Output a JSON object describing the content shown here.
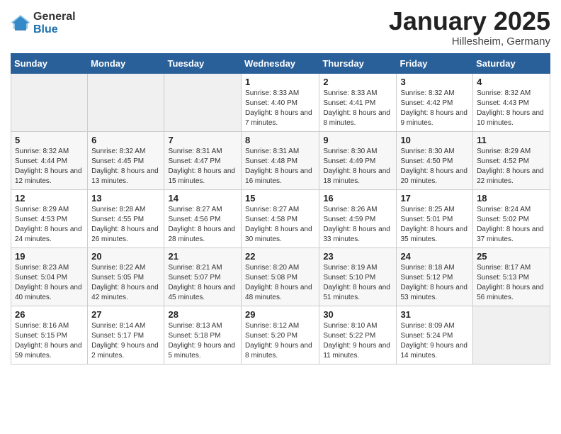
{
  "logo": {
    "general": "General",
    "blue": "Blue"
  },
  "header": {
    "month": "January 2025",
    "location": "Hillesheim, Germany"
  },
  "weekdays": [
    "Sunday",
    "Monday",
    "Tuesday",
    "Wednesday",
    "Thursday",
    "Friday",
    "Saturday"
  ],
  "weeks": [
    [
      {
        "day": "",
        "sunrise": "",
        "sunset": "",
        "daylight": ""
      },
      {
        "day": "",
        "sunrise": "",
        "sunset": "",
        "daylight": ""
      },
      {
        "day": "",
        "sunrise": "",
        "sunset": "",
        "daylight": ""
      },
      {
        "day": "1",
        "sunrise": "Sunrise: 8:33 AM",
        "sunset": "Sunset: 4:40 PM",
        "daylight": "Daylight: 8 hours and 7 minutes."
      },
      {
        "day": "2",
        "sunrise": "Sunrise: 8:33 AM",
        "sunset": "Sunset: 4:41 PM",
        "daylight": "Daylight: 8 hours and 8 minutes."
      },
      {
        "day": "3",
        "sunrise": "Sunrise: 8:32 AM",
        "sunset": "Sunset: 4:42 PM",
        "daylight": "Daylight: 8 hours and 9 minutes."
      },
      {
        "day": "4",
        "sunrise": "Sunrise: 8:32 AM",
        "sunset": "Sunset: 4:43 PM",
        "daylight": "Daylight: 8 hours and 10 minutes."
      }
    ],
    [
      {
        "day": "5",
        "sunrise": "Sunrise: 8:32 AM",
        "sunset": "Sunset: 4:44 PM",
        "daylight": "Daylight: 8 hours and 12 minutes."
      },
      {
        "day": "6",
        "sunrise": "Sunrise: 8:32 AM",
        "sunset": "Sunset: 4:45 PM",
        "daylight": "Daylight: 8 hours and 13 minutes."
      },
      {
        "day": "7",
        "sunrise": "Sunrise: 8:31 AM",
        "sunset": "Sunset: 4:47 PM",
        "daylight": "Daylight: 8 hours and 15 minutes."
      },
      {
        "day": "8",
        "sunrise": "Sunrise: 8:31 AM",
        "sunset": "Sunset: 4:48 PM",
        "daylight": "Daylight: 8 hours and 16 minutes."
      },
      {
        "day": "9",
        "sunrise": "Sunrise: 8:30 AM",
        "sunset": "Sunset: 4:49 PM",
        "daylight": "Daylight: 8 hours and 18 minutes."
      },
      {
        "day": "10",
        "sunrise": "Sunrise: 8:30 AM",
        "sunset": "Sunset: 4:50 PM",
        "daylight": "Daylight: 8 hours and 20 minutes."
      },
      {
        "day": "11",
        "sunrise": "Sunrise: 8:29 AM",
        "sunset": "Sunset: 4:52 PM",
        "daylight": "Daylight: 8 hours and 22 minutes."
      }
    ],
    [
      {
        "day": "12",
        "sunrise": "Sunrise: 8:29 AM",
        "sunset": "Sunset: 4:53 PM",
        "daylight": "Daylight: 8 hours and 24 minutes."
      },
      {
        "day": "13",
        "sunrise": "Sunrise: 8:28 AM",
        "sunset": "Sunset: 4:55 PM",
        "daylight": "Daylight: 8 hours and 26 minutes."
      },
      {
        "day": "14",
        "sunrise": "Sunrise: 8:27 AM",
        "sunset": "Sunset: 4:56 PM",
        "daylight": "Daylight: 8 hours and 28 minutes."
      },
      {
        "day": "15",
        "sunrise": "Sunrise: 8:27 AM",
        "sunset": "Sunset: 4:58 PM",
        "daylight": "Daylight: 8 hours and 30 minutes."
      },
      {
        "day": "16",
        "sunrise": "Sunrise: 8:26 AM",
        "sunset": "Sunset: 4:59 PM",
        "daylight": "Daylight: 8 hours and 33 minutes."
      },
      {
        "day": "17",
        "sunrise": "Sunrise: 8:25 AM",
        "sunset": "Sunset: 5:01 PM",
        "daylight": "Daylight: 8 hours and 35 minutes."
      },
      {
        "day": "18",
        "sunrise": "Sunrise: 8:24 AM",
        "sunset": "Sunset: 5:02 PM",
        "daylight": "Daylight: 8 hours and 37 minutes."
      }
    ],
    [
      {
        "day": "19",
        "sunrise": "Sunrise: 8:23 AM",
        "sunset": "Sunset: 5:04 PM",
        "daylight": "Daylight: 8 hours and 40 minutes."
      },
      {
        "day": "20",
        "sunrise": "Sunrise: 8:22 AM",
        "sunset": "Sunset: 5:05 PM",
        "daylight": "Daylight: 8 hours and 42 minutes."
      },
      {
        "day": "21",
        "sunrise": "Sunrise: 8:21 AM",
        "sunset": "Sunset: 5:07 PM",
        "daylight": "Daylight: 8 hours and 45 minutes."
      },
      {
        "day": "22",
        "sunrise": "Sunrise: 8:20 AM",
        "sunset": "Sunset: 5:08 PM",
        "daylight": "Daylight: 8 hours and 48 minutes."
      },
      {
        "day": "23",
        "sunrise": "Sunrise: 8:19 AM",
        "sunset": "Sunset: 5:10 PM",
        "daylight": "Daylight: 8 hours and 51 minutes."
      },
      {
        "day": "24",
        "sunrise": "Sunrise: 8:18 AM",
        "sunset": "Sunset: 5:12 PM",
        "daylight": "Daylight: 8 hours and 53 minutes."
      },
      {
        "day": "25",
        "sunrise": "Sunrise: 8:17 AM",
        "sunset": "Sunset: 5:13 PM",
        "daylight": "Daylight: 8 hours and 56 minutes."
      }
    ],
    [
      {
        "day": "26",
        "sunrise": "Sunrise: 8:16 AM",
        "sunset": "Sunset: 5:15 PM",
        "daylight": "Daylight: 8 hours and 59 minutes."
      },
      {
        "day": "27",
        "sunrise": "Sunrise: 8:14 AM",
        "sunset": "Sunset: 5:17 PM",
        "daylight": "Daylight: 9 hours and 2 minutes."
      },
      {
        "day": "28",
        "sunrise": "Sunrise: 8:13 AM",
        "sunset": "Sunset: 5:18 PM",
        "daylight": "Daylight: 9 hours and 5 minutes."
      },
      {
        "day": "29",
        "sunrise": "Sunrise: 8:12 AM",
        "sunset": "Sunset: 5:20 PM",
        "daylight": "Daylight: 9 hours and 8 minutes."
      },
      {
        "day": "30",
        "sunrise": "Sunrise: 8:10 AM",
        "sunset": "Sunset: 5:22 PM",
        "daylight": "Daylight: 9 hours and 11 minutes."
      },
      {
        "day": "31",
        "sunrise": "Sunrise: 8:09 AM",
        "sunset": "Sunset: 5:24 PM",
        "daylight": "Daylight: 9 hours and 14 minutes."
      },
      {
        "day": "",
        "sunrise": "",
        "sunset": "",
        "daylight": ""
      }
    ]
  ]
}
